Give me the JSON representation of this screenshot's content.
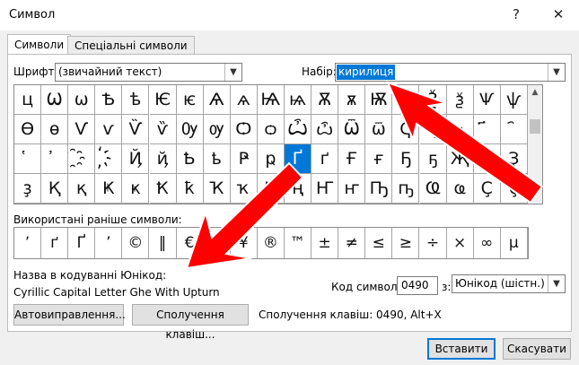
{
  "window": {
    "title": "Символ",
    "help": "?",
    "close": "✕"
  },
  "tabs": [
    {
      "label": "Символи"
    },
    {
      "label": "Спеціальні символи"
    }
  ],
  "font": {
    "label": "Шрифт:",
    "value": "(звичайний текст)"
  },
  "subset": {
    "label": "Набір:",
    "value": "кирилиця"
  },
  "grid": {
    "rows": [
      [
        "ц",
        "Ѡ",
        "ѡ",
        "Ѣ",
        "ѣ",
        "Ѥ",
        "ѥ",
        "Ѧ",
        "ѧ",
        "Ѩ",
        "ѩ",
        "Ѫ",
        "ѫ",
        "Ѭ",
        "ѭ",
        "Ѯ",
        "ѯ",
        "Ѱ",
        "ѱ"
      ],
      [
        "Ѳ",
        "ѳ",
        "Ѵ",
        "ѵ",
        "Ѷ",
        "ѷ",
        "Ѹ",
        "ѹ",
        "Ѻ",
        "ѻ",
        "Ѽ",
        "ѽ",
        "Ѿ",
        "ѿ",
        "Ҁ",
        "ҁ",
        "҂",
        "҃",
        "҄"
      ],
      [
        "҅",
        "҆",
        "҈",
        "҉",
        "Ҋ",
        "ҋ",
        "Ҍ",
        "ҍ",
        "Ҏ",
        "ҏ",
        "Ґ",
        "ґ",
        "Ғ",
        "ғ",
        "Ҕ",
        "ҕ",
        "Җ",
        "җ",
        "Ҙ"
      ],
      [
        "ҙ",
        "Қ",
        "қ",
        "Ҝ",
        "ҝ",
        "Ҟ",
        "ҟ",
        "Ҡ",
        "ҡ",
        "Ң",
        "ң",
        "Ҥ",
        "ҥ",
        "Ҧ",
        "ҧ",
        "Ҩ",
        "ҩ",
        "Ҫ",
        "ҫ"
      ]
    ],
    "selected": "Ґ"
  },
  "recent": {
    "label": "Використані раніше символи:",
    "symbols": [
      "ʼ",
      "ґ",
      "Ґ",
      "’",
      "©",
      "‖",
      "€",
      "£",
      "¥",
      "®",
      "™",
      "±",
      "≠",
      "≤",
      "≥",
      "÷",
      "×",
      "∞",
      "µ"
    ]
  },
  "unicode_name": {
    "label": "Назва в кодуванні Юнікод:",
    "value": "Cyrillic Capital Letter Ghe With Upturn"
  },
  "char_code": {
    "label": "Код символу:",
    "value": "0490"
  },
  "from": {
    "label": "з:",
    "value": "Юнікод (шістн.)"
  },
  "buttons": {
    "autocorrect": "Автовиправлення...",
    "shortcut_key": "Сполучення клавіш...",
    "insert": "Вставити",
    "cancel": "Скасувати"
  },
  "shortcut_info": "Сполучення клавіш: 0490, Alt+X",
  "colors": {
    "accent": "#0078d7",
    "arrow": "#ff0000"
  }
}
